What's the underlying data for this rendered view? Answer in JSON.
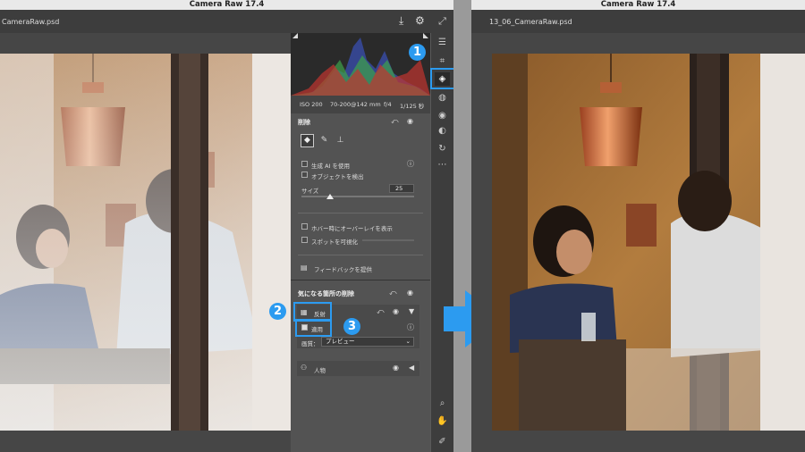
{
  "left_window": {
    "title": "Camera Raw 17.4",
    "file_tab": "CameraRaw.psd"
  },
  "right_window": {
    "title": "Camera Raw 17.4",
    "file_tab": "13_06_CameraRaw.psd"
  },
  "info_bar": {
    "iso": "ISO 200",
    "lens": "70-200@142 mm",
    "aperture": "f/4",
    "shutter": "1/125 秒"
  },
  "remove_panel": {
    "title": "削除",
    "gen_ai_label": "生成 AI を使用",
    "detect_objects_label": "オブジェクトを検出",
    "size_label": "サイズ",
    "size_value": "25",
    "size_fraction": 0.25,
    "hover_overlay_label": "ホバー時にオーバーレイを表示",
    "visualize_spots_label": "スポットを可視化",
    "feedback_label": "フィードバックを提供"
  },
  "distraction_panel": {
    "title": "気になる箇所の削除",
    "reflection_label": "反射",
    "apply_label": "適用",
    "quality_label": "画質：",
    "quality_value": "プレビュー",
    "people_label": "人物"
  },
  "callouts": {
    "one": "1",
    "two": "2",
    "three": "3"
  },
  "colors": {
    "accent": "#2c9bf0",
    "panel": "#535353",
    "toolbar": "#3d3d3d"
  }
}
